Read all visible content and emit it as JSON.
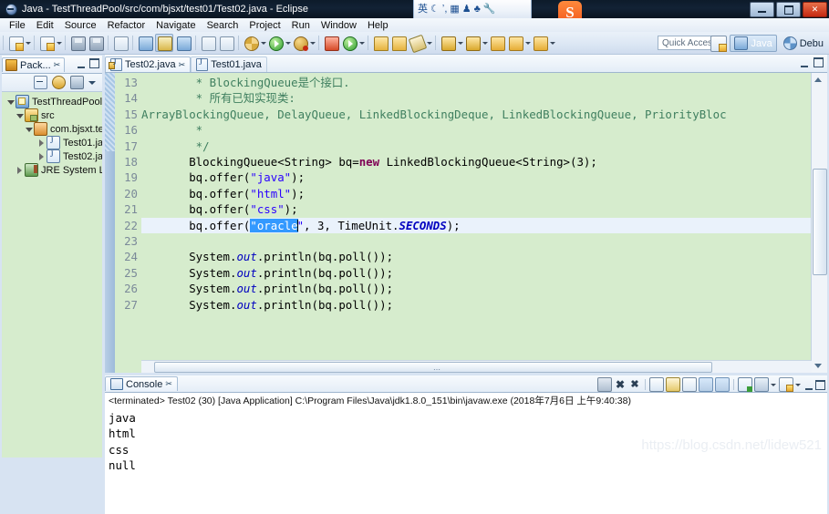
{
  "window": {
    "title": "Java - TestThreadPool/src/com/bjsxt/test01/Test02.java - Eclipse",
    "app_icon": "eclipse-icon",
    "minimize_label": "Minimize",
    "restore_label": "Restore",
    "close_label": "Close"
  },
  "ime": {
    "lang_label": "英",
    "icons": [
      "moon-icon",
      "comma-icon",
      "keyboard-icon",
      "person-icon",
      "shirt-icon",
      "wrench-icon"
    ],
    "logo_label": "S"
  },
  "menubar": {
    "items": [
      "File",
      "Edit",
      "Source",
      "Refactor",
      "Navigate",
      "Search",
      "Project",
      "Run",
      "Window",
      "Help"
    ]
  },
  "toolbar": {
    "quick_access_placeholder": "Quick Access",
    "perspective_java": "Java",
    "perspective_debug": "Debu",
    "new_button": "New",
    "save_button": "Save"
  },
  "package_explorer": {
    "tab_label": "Pack...",
    "close_glyph": "✂",
    "tree": [
      {
        "label": "TestThreadPool",
        "icon": "project-icon",
        "indent": 0,
        "twisty": "down"
      },
      {
        "label": "src",
        "icon": "source-folder-icon",
        "indent": 1,
        "twisty": "down"
      },
      {
        "label": "com.bjsxt.te",
        "icon": "package-icon",
        "indent": 2,
        "twisty": "down"
      },
      {
        "label": "Test01.ja",
        "icon": "java-file-icon",
        "indent": 3,
        "twisty": "right"
      },
      {
        "label": "Test02.ja",
        "icon": "java-file-icon",
        "indent": 3,
        "twisty": "right"
      },
      {
        "label": "JRE System Lib",
        "icon": "library-icon",
        "indent": 1,
        "twisty": "right"
      }
    ]
  },
  "editor": {
    "tabs": [
      {
        "label": "Test02.java",
        "active": true,
        "dirty": false,
        "close_glyph": "✂"
      },
      {
        "label": "Test01.java",
        "active": false,
        "dirty": false,
        "close_glyph": ""
      }
    ],
    "first_line_number": 13,
    "lines": [
      {
        "n": 13,
        "segments": [
          {
            "t": "        * BlockingQueue是个接口.",
            "c": "cm"
          }
        ]
      },
      {
        "n": 14,
        "segments": [
          {
            "t": "        * 所有已知实现类:",
            "c": "cm"
          }
        ]
      },
      {
        "n": 15,
        "segments": [
          {
            "t": "ArrayBlockingQueue, DelayQueue, LinkedBlockingDeque, LinkedBlockingQueue, PriorityBloc",
            "c": "cm"
          }
        ]
      },
      {
        "n": 16,
        "segments": [
          {
            "t": "        *",
            "c": "cm"
          }
        ]
      },
      {
        "n": 17,
        "segments": [
          {
            "t": "        */",
            "c": "cm"
          }
        ]
      },
      {
        "n": 18,
        "segments": [
          {
            "t": "       BlockingQueue<String> bq=",
            "c": ""
          },
          {
            "t": "new",
            "c": "kw"
          },
          {
            "t": " LinkedBlockingQueue<String>(3);",
            "c": ""
          }
        ]
      },
      {
        "n": 19,
        "segments": [
          {
            "t": "       bq.offer(",
            "c": ""
          },
          {
            "t": "\"java\"",
            "c": "st"
          },
          {
            "t": ");",
            "c": ""
          }
        ]
      },
      {
        "n": 20,
        "segments": [
          {
            "t": "       bq.offer(",
            "c": ""
          },
          {
            "t": "\"html\"",
            "c": "st"
          },
          {
            "t": ");",
            "c": ""
          }
        ]
      },
      {
        "n": 21,
        "segments": [
          {
            "t": "       bq.offer(",
            "c": ""
          },
          {
            "t": "\"css\"",
            "c": "st"
          },
          {
            "t": ");",
            "c": ""
          }
        ]
      },
      {
        "n": 22,
        "segments": [
          {
            "t": "       bq.offer(",
            "c": ""
          },
          {
            "t": "\"oracle",
            "c": "sel"
          },
          {
            "t": "\"",
            "c": "st"
          },
          {
            "t": ", 3, TimeUnit.",
            "c": ""
          },
          {
            "t": "SECONDS",
            "c": "fl"
          },
          {
            "t": ");",
            "c": ""
          }
        ]
      },
      {
        "n": 23,
        "segments": [
          {
            "t": "",
            "c": ""
          }
        ]
      },
      {
        "n": 24,
        "segments": [
          {
            "t": "       System.",
            "c": ""
          },
          {
            "t": "out",
            "c": "fld"
          },
          {
            "t": ".println(bq.poll());",
            "c": ""
          }
        ]
      },
      {
        "n": 25,
        "segments": [
          {
            "t": "       System.",
            "c": ""
          },
          {
            "t": "out",
            "c": "fld"
          },
          {
            "t": ".println(bq.poll());",
            "c": ""
          }
        ]
      },
      {
        "n": 26,
        "segments": [
          {
            "t": "       System.",
            "c": ""
          },
          {
            "t": "out",
            "c": "fld"
          },
          {
            "t": ".println(bq.poll());",
            "c": ""
          }
        ]
      },
      {
        "n": 27,
        "segments": [
          {
            "t": "       System.",
            "c": ""
          },
          {
            "t": "out",
            "c": "fld"
          },
          {
            "t": ".println(bq.poll());",
            "c": ""
          }
        ]
      }
    ],
    "highlighted_line": 22,
    "selection_text": "\"oracle"
  },
  "console": {
    "tab_label": "Console",
    "close_glyph": "✂",
    "status_line": "<terminated> Test02 (30) [Java Application] C:\\Program Files\\Java\\jdk1.8.0_151\\bin\\javaw.exe (2018年7月6日 上午9:40:38)",
    "output": [
      "java",
      "html",
      "css",
      "null"
    ],
    "tool_icons": [
      "terminate-icon",
      "remove-launch-icon",
      "remove-all-icon",
      "clear-console-icon",
      "lock-scroll-icon",
      "show-on-output-icon",
      "pin-console-icon",
      "display-selected-console-icon",
      "open-console-icon",
      "new-console-view-icon"
    ]
  },
  "watermark": {
    "text": "https://blog.csdn.net/lidew521"
  }
}
